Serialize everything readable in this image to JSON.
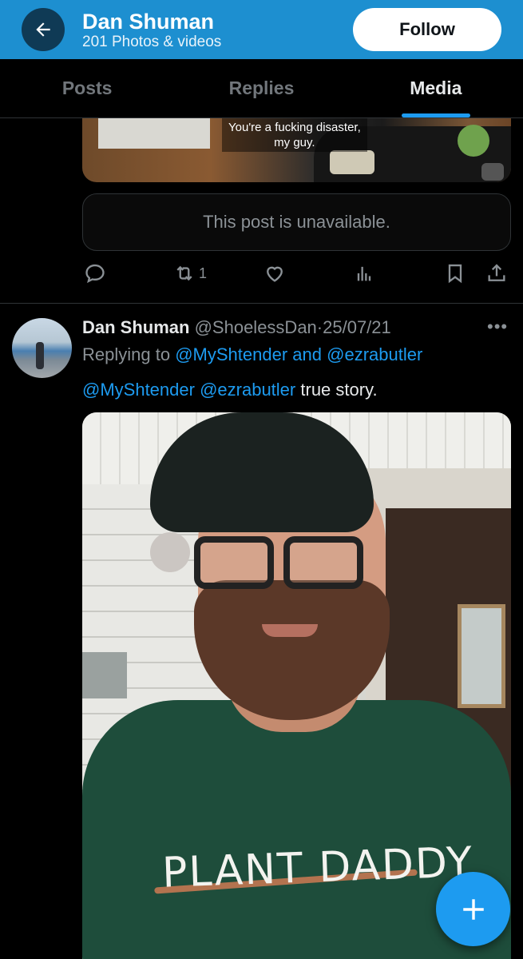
{
  "header": {
    "title": "Dan Shuman",
    "subtitle": "201 Photos & videos",
    "follow_label": "Follow"
  },
  "tabs": [
    {
      "label": "Posts",
      "active": false
    },
    {
      "label": "Replies",
      "active": false
    },
    {
      "label": "Media",
      "active": true
    }
  ],
  "first_post": {
    "media_caption_line1": "You're a fucking disaster,",
    "media_caption_line2": "my guy.",
    "unavailable_text": "This post is unavailable.",
    "retweet_count": "1"
  },
  "second_post": {
    "name": "Dan Shuman",
    "handle": "@ShoelessDan",
    "separator": "·",
    "date": "25/07/21",
    "more_label": "•••",
    "replying_prefix": "Replying to",
    "replying_to_1": "@MyShtender",
    "replying_and": "and",
    "replying_to_2": "@ezrabutler",
    "text_mention_1": "@MyShtender",
    "text_mention_2": "@ezrabutler",
    "text_body": "true story.",
    "photo_shirt_text": "PLANT DADDY"
  },
  "colors": {
    "header_bg": "#1d8fd0",
    "accent": "#1d9bf0",
    "background": "#000000"
  },
  "icons": [
    "back-arrow-icon",
    "reply-icon",
    "retweet-icon",
    "like-icon",
    "analytics-icon",
    "bookmark-icon",
    "share-icon",
    "more-icon",
    "plus-icon"
  ]
}
